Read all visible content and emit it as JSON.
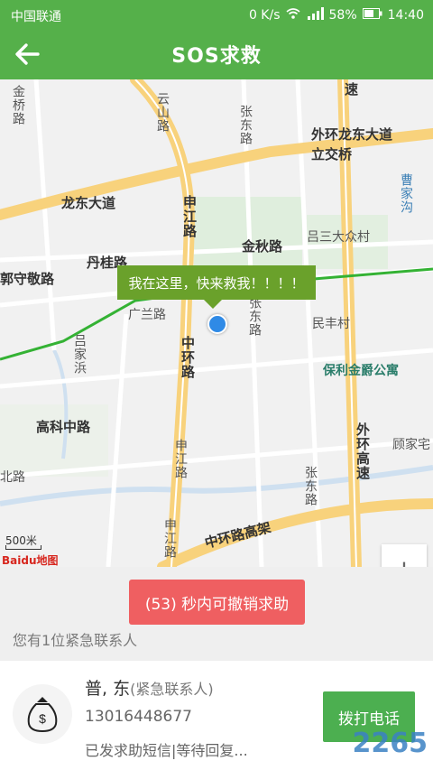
{
  "status_bar": {
    "carrier": "中国联通",
    "speed": "0 K/s",
    "signal": "4G",
    "battery": "58%",
    "time": "14:40"
  },
  "header": {
    "title": "SOS求救",
    "back_icon": "back-arrow-icon"
  },
  "map": {
    "labels": {
      "jinqiao": "金桥路",
      "yungong": "云山路",
      "zhangdong": "张东路",
      "waihuan_interchange": "外环龙东大道立交桥",
      "su_top": "速",
      "longdong": "龙东大道",
      "shenjiang": "申江路",
      "jinqiu": "金秋路",
      "lvsan": "吕三大众村",
      "dangui": "丹桂路",
      "yingshou": "郭守敬路",
      "guangfang": "广兰路",
      "zhangdong2": "张东路",
      "minfeng": "民丰村",
      "zhonghuan": "中环路",
      "baoli": "保利金爵公寓",
      "tangjiabang": "吕家浜",
      "gaoke": "高科中路",
      "waihuan_gaosu": "外环高速",
      "gujiazhai": "顾家宅",
      "shenjiang2": "申江路",
      "zhangdong3": "张东路",
      "zhonghuan_elev": "中环路高架",
      "caojiagou": "曹家沟",
      "bei": "北路"
    },
    "bubble": "我在这里，快来救我！！！！",
    "scale": "500米",
    "logo": "Baidu地图",
    "zoom_in": "+",
    "zoom_out": "−"
  },
  "countdown": {
    "label": "(53) 秒内可撤销求助"
  },
  "contacts_hint": "您有1位紧急联系人",
  "contact": {
    "name": "普, 东",
    "tag": "(紧急联系人)",
    "phone": "13016448677",
    "status": "已发求助短信|等待回复...",
    "call_label": "拨打电话"
  },
  "watermark": "2265",
  "colors": {
    "header": "#55b04a",
    "bubble": "#6aa12b",
    "countdown": "#ef5f61",
    "call": "#4caf50"
  }
}
